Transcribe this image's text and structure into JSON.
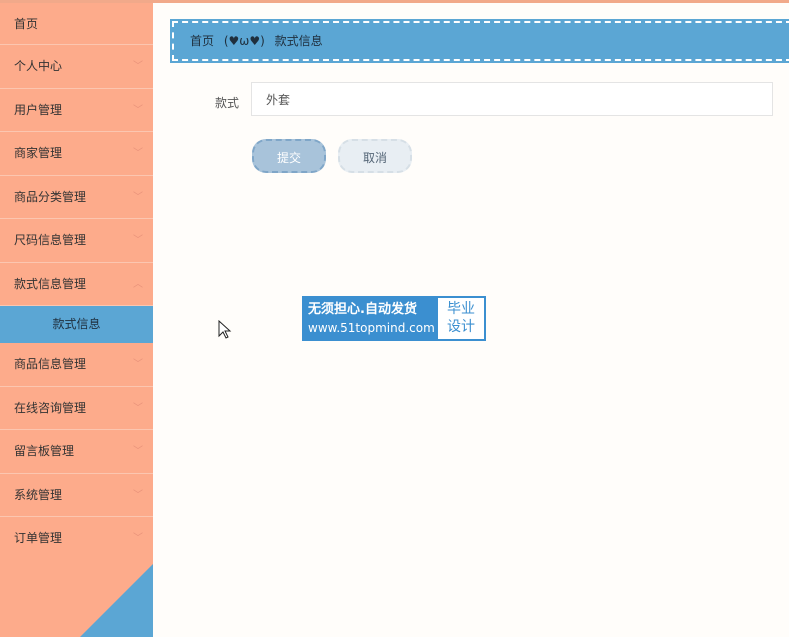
{
  "sidebar": {
    "items": [
      {
        "label": "首页"
      },
      {
        "label": "个人中心"
      },
      {
        "label": "用户管理"
      },
      {
        "label": "商家管理"
      },
      {
        "label": "商品分类管理"
      },
      {
        "label": "尺码信息管理"
      },
      {
        "label": "款式信息管理"
      }
    ],
    "sub_item": "款式信息",
    "items_after": [
      {
        "label": "商品信息管理"
      },
      {
        "label": "在线咨询管理"
      },
      {
        "label": "留言板管理"
      },
      {
        "label": "系统管理"
      },
      {
        "label": "订单管理"
      }
    ]
  },
  "breadcrumb": {
    "home": "首页",
    "separator": "(♥ω♥)",
    "current": "款式信息"
  },
  "form": {
    "label": "款式",
    "value": "外套"
  },
  "buttons": {
    "submit": "提交",
    "cancel": "取消"
  },
  "watermark": {
    "line1": "无须担心.自动发货",
    "line2": "www.51topmind.com",
    "right1": "毕业",
    "right2": "设计"
  },
  "colors": {
    "sidebar": "#fdab8b",
    "accent": "#5ba6d4",
    "submit": "#a8c3da",
    "cancel": "#e8eef3"
  }
}
